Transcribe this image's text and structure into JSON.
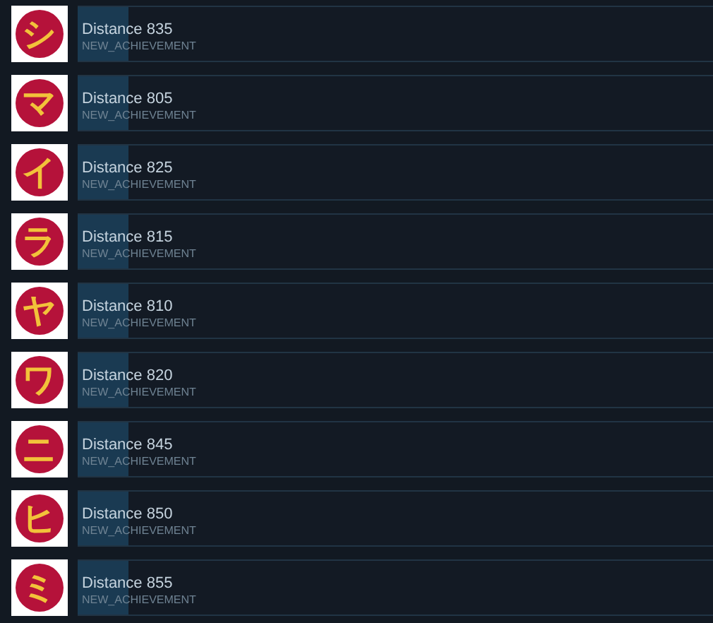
{
  "achievements": [
    {
      "glyph": "シ",
      "title": "Distance 835",
      "api_name": "NEW_ACHIEVEMENT",
      "level": 0.08
    },
    {
      "glyph": "マ",
      "title": "Distance 805",
      "api_name": "NEW_ACHIEVEMENT",
      "level": 0.08
    },
    {
      "glyph": "イ",
      "title": "Distance 825",
      "api_name": "NEW_ACHIEVEMENT",
      "level": 0.08
    },
    {
      "glyph": "ラ",
      "title": "Distance 815",
      "api_name": "NEW_ACHIEVEMENT",
      "level": 0.08
    },
    {
      "glyph": "ヤ",
      "title": "Distance 810",
      "api_name": "NEW_ACHIEVEMENT",
      "level": 0.08
    },
    {
      "glyph": "ワ",
      "title": "Distance 820",
      "api_name": "NEW_ACHIEVEMENT",
      "level": 0.08
    },
    {
      "glyph": "ニ",
      "title": "Distance 845",
      "api_name": "NEW_ACHIEVEMENT",
      "level": 0.08
    },
    {
      "glyph": "ヒ",
      "title": "Distance 850",
      "api_name": "NEW_ACHIEVEMENT",
      "level": 0.08
    },
    {
      "glyph": "ミ",
      "title": "Distance 855",
      "api_name": "NEW_ACHIEVEMENT",
      "level": 0.08
    }
  ]
}
